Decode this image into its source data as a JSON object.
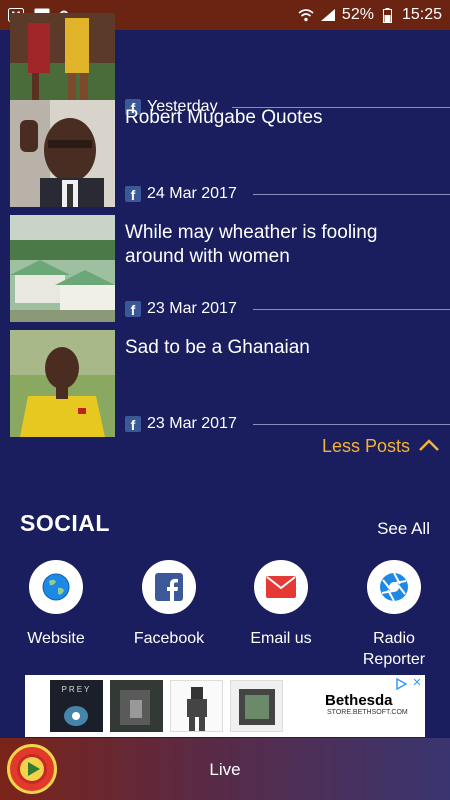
{
  "status_bar": {
    "battery": "52%",
    "time": "15:25",
    "icons": [
      "alert-icon",
      "image-icon",
      "key-icon",
      "wifi-icon",
      "signal-icon",
      "battery-icon"
    ]
  },
  "posts": [
    {
      "title": "",
      "date": "Yesterday",
      "source_icon": "facebook-icon",
      "thumb": "football-players"
    },
    {
      "title": "Robert Mugabe Quotes",
      "date": "24 Mar 2017",
      "source_icon": "facebook-icon",
      "thumb": "mugabe-portrait"
    },
    {
      "title": "While may wheather is fooling around with women",
      "date": "23 Mar 2017",
      "source_icon": "facebook-icon",
      "thumb": "houses"
    },
    {
      "title": "Sad to be a Ghanaian",
      "date": "23 Mar 2017",
      "source_icon": "facebook-icon",
      "thumb": "coach-yellow-shirt"
    }
  ],
  "less_posts": "Less Posts",
  "social": {
    "heading": "SOCIAL",
    "see_all": "See All",
    "items": [
      {
        "label": "Website",
        "icon": "globe-icon",
        "color": "#1e88e5"
      },
      {
        "label": "Facebook",
        "icon": "facebook-icon",
        "color": "#3b5998"
      },
      {
        "label": "Email us",
        "icon": "email-icon",
        "color": "#e53935"
      },
      {
        "label": "Radio Reporter",
        "icon": "camera-aperture-icon",
        "color": "#1e88e5"
      }
    ]
  },
  "ad": {
    "brand": "Bethesda",
    "url": "STORE.BETHSOFT.COM",
    "game_title": "PREY"
  },
  "player": {
    "label": "Live"
  }
}
